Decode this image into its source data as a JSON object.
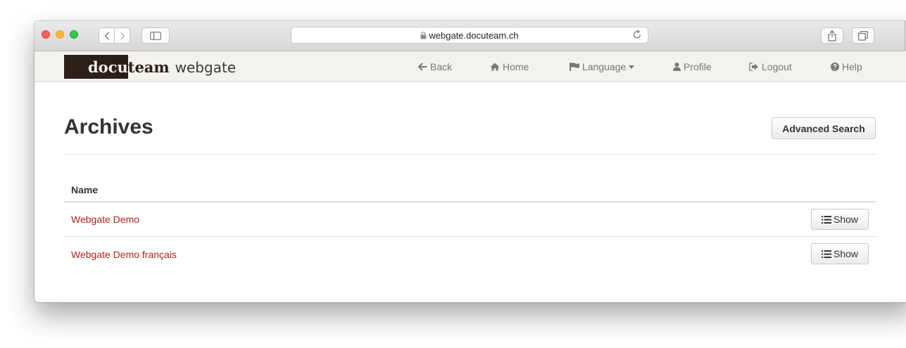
{
  "browser": {
    "url": "webgate.docuteam.ch",
    "icons": [
      "back-chevron-icon",
      "forward-chevron-icon",
      "sidebar-icon",
      "lock-icon",
      "reload-icon",
      "share-icon",
      "tabs-icon",
      "plus-icon"
    ],
    "new_tab_glyph": "+"
  },
  "site": {
    "logo": {
      "part1": "docu",
      "part2": "team",
      "part3": "webgate"
    },
    "nav": {
      "back": "Back",
      "home": "Home",
      "language": "Language",
      "profile": "Profile",
      "logout": "Logout",
      "help": "Help"
    }
  },
  "main": {
    "title": "Archives",
    "advanced_search": "Advanced Search",
    "table": {
      "header": "Name",
      "rows": [
        {
          "name": "Webgate Demo",
          "action": "Show"
        },
        {
          "name": "Webgate Demo français",
          "action": "Show"
        }
      ]
    }
  },
  "colors": {
    "link": "#b0221e",
    "navbar_bg": "#f3f2ef",
    "logo_dark": "#2b1f17"
  }
}
